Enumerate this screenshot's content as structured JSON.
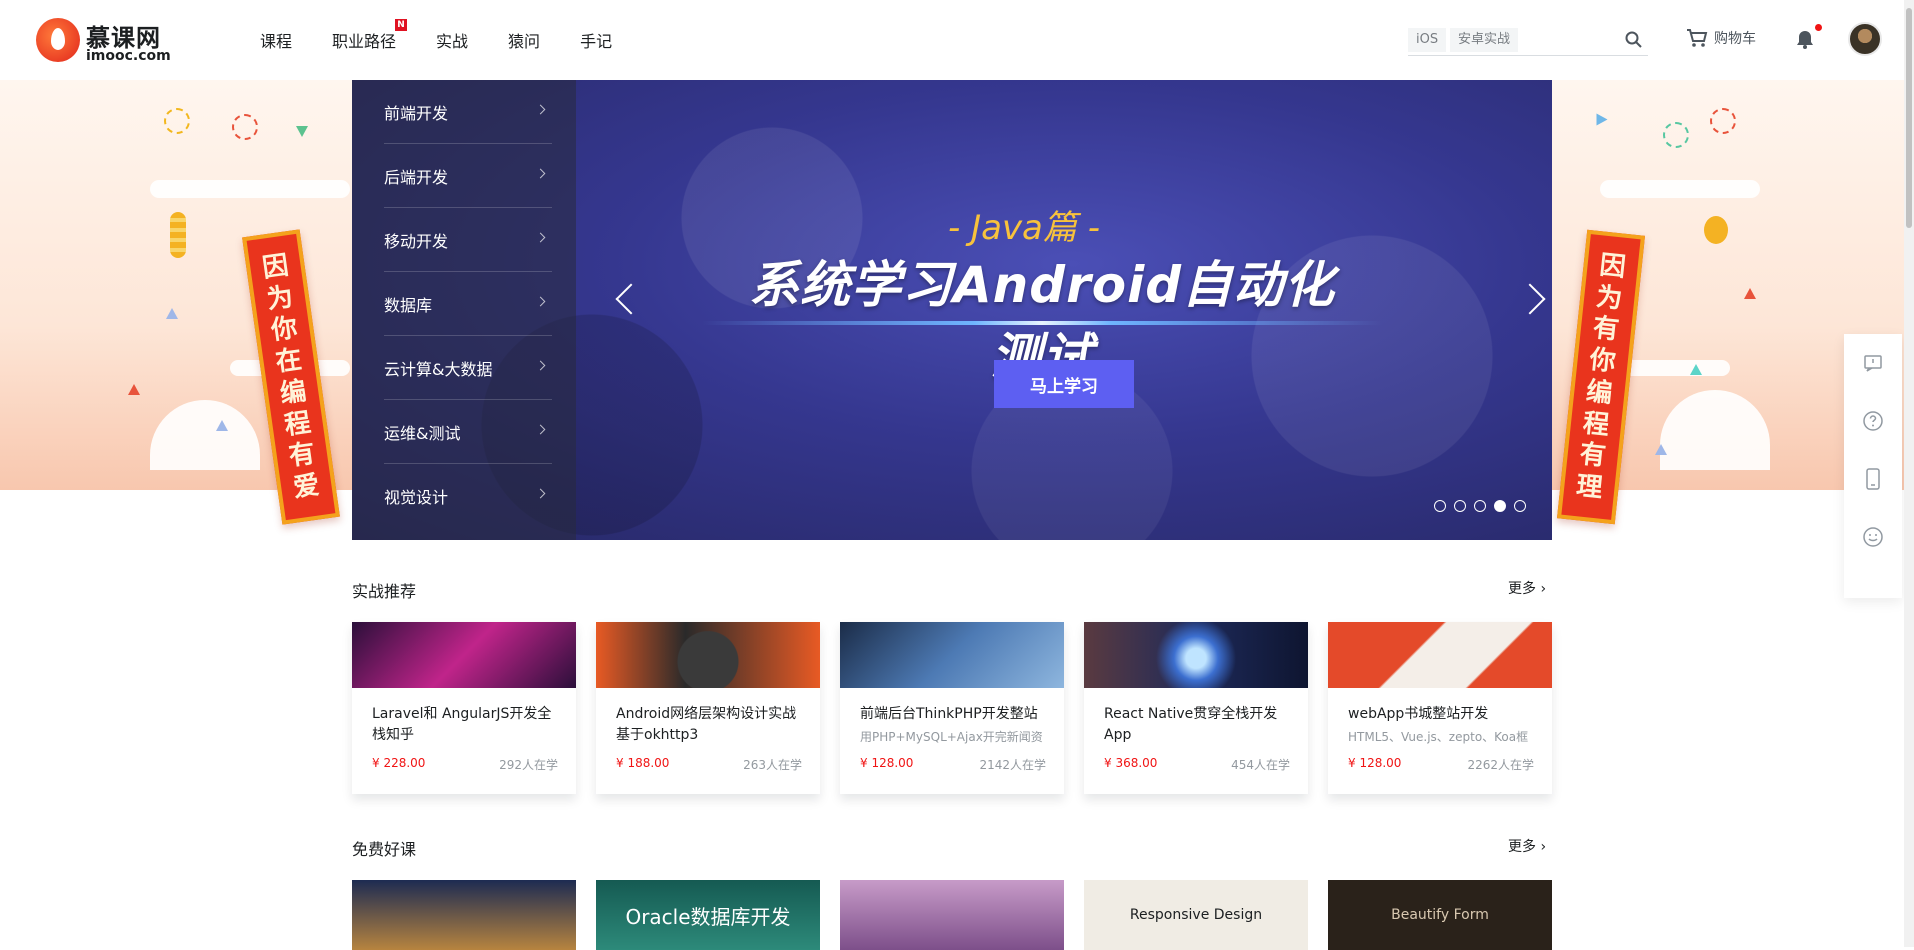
{
  "header": {
    "logo_cn": "慕课网",
    "logo_en": "imooc.com",
    "nav": [
      {
        "label": "课程"
      },
      {
        "label": "职业路径",
        "badge": "N"
      },
      {
        "label": "实战"
      },
      {
        "label": "猿问"
      },
      {
        "label": "手记"
      }
    ],
    "search": {
      "hot_tags": [
        "iOS",
        "安卓实战"
      ],
      "placeholder": ""
    },
    "cart_label": "购物车"
  },
  "hero": {
    "left_couplet": [
      "因",
      "为",
      "你",
      "在",
      "编",
      "程",
      "有",
      "爱"
    ],
    "right_couplet": [
      "因",
      "为",
      "有",
      "你",
      "编",
      "程",
      "有",
      "理"
    ]
  },
  "banner": {
    "categories": [
      "前端开发",
      "后端开发",
      "移动开发",
      "数据库",
      "云计算&大数据",
      "运维&测试",
      "视觉设计"
    ],
    "subtitle": "- Java篇 -",
    "title": "系统学习Android自动化测试",
    "cta_label": "马上学习",
    "slide_count": 5,
    "active_slide": 4
  },
  "sections": {
    "practical": {
      "title": "实战推荐",
      "more": "更多",
      "cards": [
        {
          "title": "Laravel和 AngularJS开发全栈知乎",
          "desc": "",
          "price": "¥ 228.00",
          "learners": "292人在学",
          "color": "#6b2a6e"
        },
        {
          "title": "Android网络层架构设计实战 基于okhttp3",
          "desc": "",
          "price": "¥ 188.00",
          "learners": "263人在学",
          "color": "#e85a24"
        },
        {
          "title": "前端后台ThinkPHP开发整站",
          "desc": "用PHP+MySQL+Ajax开完新闻资",
          "price": "¥ 128.00",
          "learners": "2142人在学",
          "color": "#2f4d78"
        },
        {
          "title": "React Native贯穿全栈开发 App",
          "desc": "",
          "price": "¥ 368.00",
          "learners": "454人在学",
          "color": "#3a2f55"
        },
        {
          "title": "webApp书城整站开发",
          "desc": "HTML5、Vue.js、zepto、Koa框",
          "price": "¥ 128.00",
          "learners": "2262人在学",
          "color": "#e44a2a"
        }
      ]
    },
    "free": {
      "title": "免费好课",
      "more": "更多",
      "cards": [
        {
          "label": "",
          "color": "#2e3f66"
        },
        {
          "label": "Oracle数据库开发",
          "color": "#1f6b5e"
        },
        {
          "label": "",
          "color": "#a97fb0"
        },
        {
          "label": "Responsive Design",
          "color": "#f0ece4"
        },
        {
          "label": "Beautify Form",
          "color": "#2a221a"
        }
      ]
    }
  },
  "colors": {
    "accent": "#5d5ff2",
    "price": "#f01414",
    "brand_red": "#e1251b"
  }
}
